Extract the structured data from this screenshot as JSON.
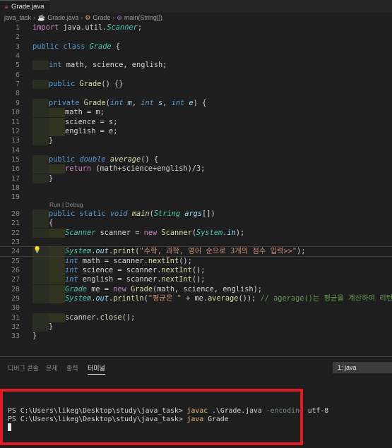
{
  "tab": {
    "title": "Grade.java"
  },
  "breadcrumb": {
    "folder": "java_task",
    "file": "Grade.java",
    "class": "Grade",
    "method": "main(String[])"
  },
  "code": {
    "line_numbers": [
      "1",
      "2",
      "3",
      "4",
      "5",
      "6",
      "7",
      "8",
      "9",
      "10",
      "11",
      "12",
      "13",
      "14",
      "15",
      "16",
      "17",
      "18",
      "19",
      "20",
      "21",
      "22",
      "23",
      "24",
      "25",
      "26",
      "27",
      "28",
      "29",
      "30",
      "31",
      "32",
      "33"
    ],
    "codelens": "Run | Debug",
    "l1": [
      "import",
      " java.util.",
      "Scanner",
      ";"
    ],
    "l3": [
      "public",
      " ",
      "class",
      " ",
      "Grade",
      " {"
    ],
    "l5": [
      "int",
      " math, science, english;"
    ],
    "l7": [
      "public",
      " ",
      "Grade",
      "() {}"
    ],
    "l9": [
      "private",
      " ",
      "Grade",
      "(",
      "int",
      " ",
      "m",
      ", ",
      "int",
      " ",
      "s",
      ", ",
      "int",
      " ",
      "e",
      ") {"
    ],
    "l10": "math = m;",
    "l11": "science = s;",
    "l12": "english = e;",
    "l13": "}",
    "l15": [
      "public",
      " ",
      "double",
      " ",
      "average",
      "() {"
    ],
    "l16": [
      "return",
      " (math+science+english)/",
      "3",
      ";"
    ],
    "l17": "}",
    "l20": [
      "public",
      " ",
      "static",
      " ",
      "void",
      " ",
      "main",
      "(",
      "String",
      " ",
      "args",
      "[])"
    ],
    "l21": "{",
    "l22": [
      "Scanner",
      " scanner = ",
      "new",
      " ",
      "Scanner",
      "(",
      "System",
      ".",
      "in",
      ");"
    ],
    "l24": [
      "System",
      ".",
      "out",
      ".",
      "print",
      "(",
      "\"수학, 과학, 영어 순으로 3개의 점수 입력>>\"",
      ");"
    ],
    "l25": [
      "int",
      " math = scanner.",
      "nextInt",
      "();"
    ],
    "l26": [
      "int",
      " science = scanner.",
      "nextInt",
      "();"
    ],
    "l27": [
      "int",
      " english = scanner.",
      "nextInt",
      "();"
    ],
    "l28": [
      "Grade",
      " me = ",
      "new",
      " ",
      "Grade",
      "(math, science, english);"
    ],
    "l29": [
      "System",
      ".",
      "out",
      ".",
      "println",
      "(",
      "\"평균은 \"",
      " + me.",
      "average",
      "()); ",
      "// agerage()는 평균을 계산하여 리턴"
    ],
    "l31": [
      "scanner.",
      "close",
      "();"
    ],
    "l32": "}",
    "l33": "}"
  },
  "panel": {
    "tabs": [
      "디버그 콘솔",
      "문제",
      "출력",
      "터미널"
    ],
    "active_tab": "터미널",
    "terminal_select": "1: java"
  },
  "terminal": {
    "line1_prompt": "PS C:\\Users\\likeg\\Desktop\\study\\java_task> ",
    "line1_cmd": "javac",
    "line1_arg": " .\\Grade.java ",
    "line1_flag": "-encoding",
    "line1_val": " utf-8",
    "line2_prompt": "PS C:\\Users\\likeg\\Desktop\\study\\java_task> ",
    "line2_cmd": "java",
    "line2_arg": " Grade"
  },
  "icons": {
    "tab_icon": "java-file-icon",
    "lightbulb": "lightbulb-icon"
  },
  "colors": {
    "highlight_border": "#e01b24",
    "keyword": "#569cd6",
    "type": "#4ec9b0",
    "function": "#dcdcaa",
    "string": "#ce9178"
  }
}
